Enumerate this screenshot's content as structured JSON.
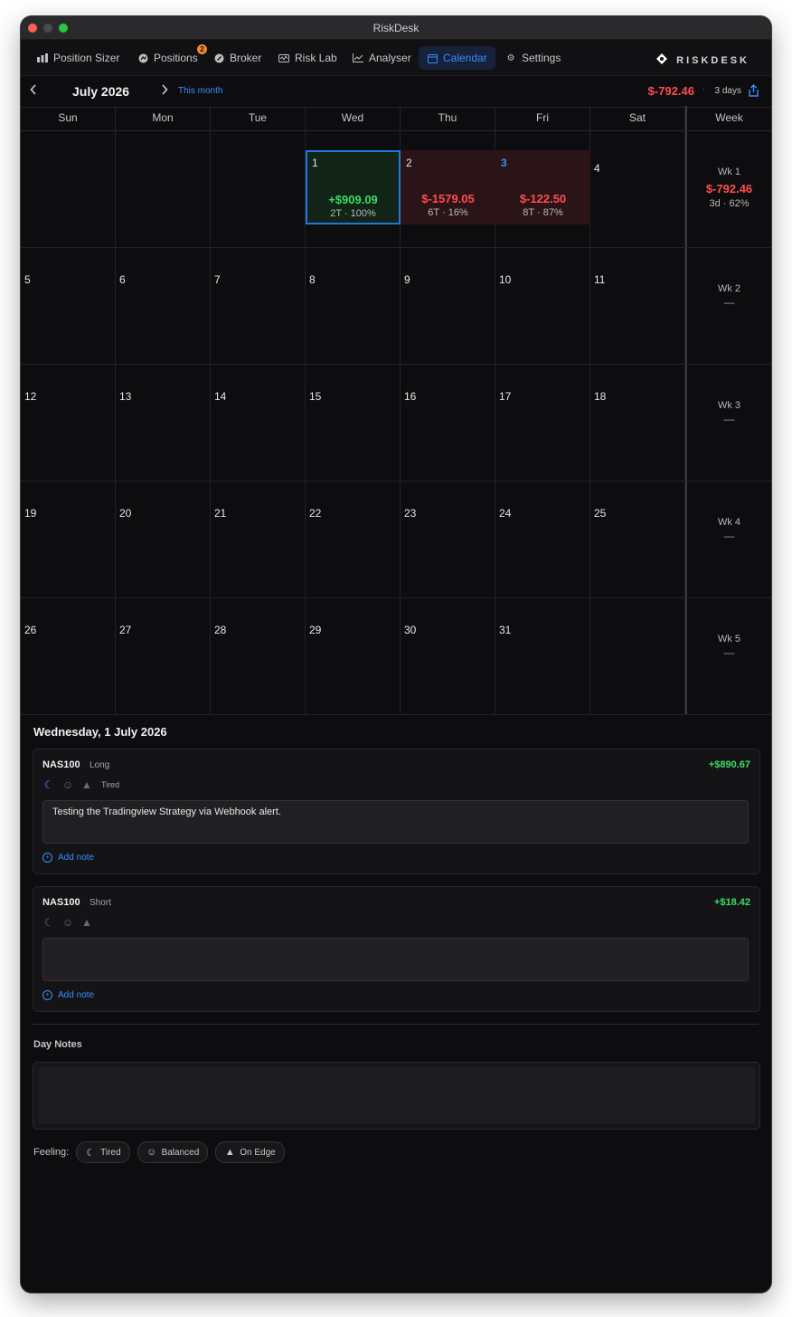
{
  "window": {
    "title": "RiskDesk"
  },
  "nav": {
    "items": [
      {
        "label": "Position Sizer",
        "icon": "bar-chart-icon"
      },
      {
        "label": "Positions",
        "icon": "positions-icon",
        "badge": "2"
      },
      {
        "label": "Broker",
        "icon": "broker-icon"
      },
      {
        "label": "Risk Lab",
        "icon": "risk-lab-icon"
      },
      {
        "label": "Analyser",
        "icon": "analyser-icon"
      },
      {
        "label": "Calendar",
        "icon": "calendar-icon",
        "active": true
      },
      {
        "label": "Settings",
        "icon": "gear-icon"
      }
    ],
    "brand": "RISKDESK"
  },
  "month_bar": {
    "month": "July 2026",
    "this_month": "This month",
    "pnl": "$-792.46",
    "separator": "·",
    "days": "3 days"
  },
  "calendar": {
    "headers": [
      "Sun",
      "Mon",
      "Tue",
      "Wed",
      "Thu",
      "Fri",
      "Sat",
      "Week"
    ],
    "days": {
      "d1": {
        "num": "1",
        "pnl": "+$909.09",
        "sub": "2T · 100%"
      },
      "d2": {
        "num": "2",
        "pnl": "$-1579.05",
        "sub": "6T · 16%"
      },
      "d3": {
        "num": "3",
        "pnl": "$-122.50",
        "sub": "8T · 87%"
      }
    },
    "weeks": [
      {
        "label": "Wk 1",
        "pnl": "$-792.46",
        "sub": "3d · 62%"
      },
      {
        "label": "Wk 2",
        "dash": "—"
      },
      {
        "label": "Wk 3",
        "dash": "—"
      },
      {
        "label": "Wk 4",
        "dash": "—"
      },
      {
        "label": "Wk 5",
        "dash": "—"
      }
    ]
  },
  "detail": {
    "title": "Wednesday, 1 July 2026",
    "trades": [
      {
        "symbol": "NAS100",
        "side": "Long",
        "pnl": "+$890.67",
        "feeling": "Tired",
        "note": "Testing the Tradingview Strategy via Webhook alert.",
        "add_note": "Add note"
      },
      {
        "symbol": "NAS100",
        "side": "Short",
        "pnl": "+$18.42",
        "feeling": "",
        "note": "",
        "add_note": "Add note"
      }
    ],
    "day_notes_label": "Day Notes",
    "feeling_label": "Feeling:",
    "feeling_chips": [
      "Tired",
      "Balanced",
      "On Edge"
    ]
  },
  "colors": {
    "accent": "#3b8cff",
    "profit": "#3ddc66",
    "loss": "#ff4d4f",
    "badge": "#f08a2a"
  }
}
